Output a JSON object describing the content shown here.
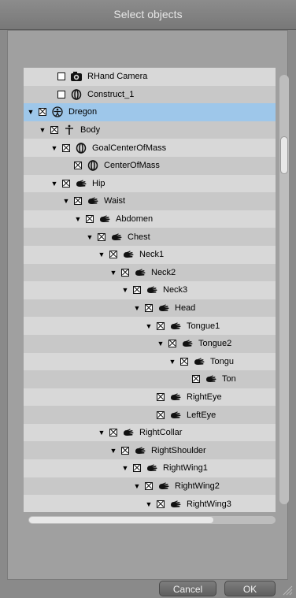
{
  "dialog": {
    "title": "Select objects"
  },
  "tree": {
    "rows": [
      {
        "label": "RHand Camera",
        "arrow": "",
        "check": "empty",
        "icon": "camera-icon",
        "indent": 0,
        "sel": false
      },
      {
        "label": "Construct_1",
        "arrow": "",
        "check": "empty",
        "icon": "prop-icon",
        "indent": 0,
        "sel": false
      },
      {
        "label": "Dregon",
        "arrow": "down",
        "check": "x",
        "icon": "figure-icon",
        "indent": 0,
        "sel": true
      },
      {
        "label": "Body",
        "arrow": "down",
        "check": "x",
        "icon": "bodypart-icon",
        "indent": 1,
        "sel": false
      },
      {
        "label": "GoalCenterOfMass",
        "arrow": "down",
        "check": "x",
        "icon": "prop-icon",
        "indent": 2,
        "sel": false
      },
      {
        "label": "CenterOfMass",
        "arrow": "",
        "check": "x",
        "icon": "prop-icon",
        "indent": 3,
        "sel": false
      },
      {
        "label": "Hip",
        "arrow": "down",
        "check": "x",
        "icon": "hand-icon",
        "indent": 2,
        "sel": false
      },
      {
        "label": "Waist",
        "arrow": "down",
        "check": "x",
        "icon": "hand-icon",
        "indent": 3,
        "sel": false
      },
      {
        "label": "Abdomen",
        "arrow": "down",
        "check": "x",
        "icon": "hand-icon",
        "indent": 4,
        "sel": false
      },
      {
        "label": "Chest",
        "arrow": "down",
        "check": "x",
        "icon": "hand-icon",
        "indent": 5,
        "sel": false
      },
      {
        "label": "Neck1",
        "arrow": "down",
        "check": "x",
        "icon": "hand-icon",
        "indent": 6,
        "sel": false
      },
      {
        "label": "Neck2",
        "arrow": "down",
        "check": "x",
        "icon": "hand-icon",
        "indent": 7,
        "sel": false
      },
      {
        "label": "Neck3",
        "arrow": "down",
        "check": "x",
        "icon": "hand-icon",
        "indent": 8,
        "sel": false
      },
      {
        "label": "Head",
        "arrow": "down",
        "check": "x",
        "icon": "hand-icon",
        "indent": 9,
        "sel": false
      },
      {
        "label": "Tongue1",
        "arrow": "down",
        "check": "x",
        "icon": "hand-icon",
        "indent": 10,
        "sel": false
      },
      {
        "label": "Tongue2",
        "arrow": "down",
        "check": "x",
        "icon": "hand-icon",
        "indent": 11,
        "sel": false
      },
      {
        "label": "Tongu",
        "arrow": "down",
        "check": "x",
        "icon": "hand-icon",
        "indent": 12,
        "sel": false
      },
      {
        "label": "Ton",
        "arrow": "",
        "check": "x",
        "icon": "hand-icon",
        "indent": 13,
        "sel": false
      },
      {
        "label": "RightEye",
        "arrow": "",
        "check": "x",
        "icon": "hand-icon",
        "indent": 10,
        "sel": false
      },
      {
        "label": "LeftEye",
        "arrow": "",
        "check": "x",
        "icon": "hand-icon",
        "indent": 10,
        "sel": false
      },
      {
        "label": "RightCollar",
        "arrow": "down",
        "check": "x",
        "icon": "hand-icon",
        "indent": 6,
        "sel": false
      },
      {
        "label": "RightShoulder",
        "arrow": "down",
        "check": "x",
        "icon": "hand-icon",
        "indent": 7,
        "sel": false
      },
      {
        "label": "RightWing1",
        "arrow": "down",
        "check": "x",
        "icon": "hand-icon",
        "indent": 8,
        "sel": false
      },
      {
        "label": "RightWing2",
        "arrow": "down",
        "check": "x",
        "icon": "hand-icon",
        "indent": 9,
        "sel": false
      },
      {
        "label": "RightWing3",
        "arrow": "down",
        "check": "x",
        "icon": "hand-icon",
        "indent": 10,
        "sel": false
      }
    ]
  },
  "buttons": {
    "cancel": "Cancel",
    "ok": "OK"
  },
  "colors": {
    "selected_row": "#9ec7ea",
    "row_light": "#d8d8d8",
    "row_dark": "#c8c8c8"
  }
}
